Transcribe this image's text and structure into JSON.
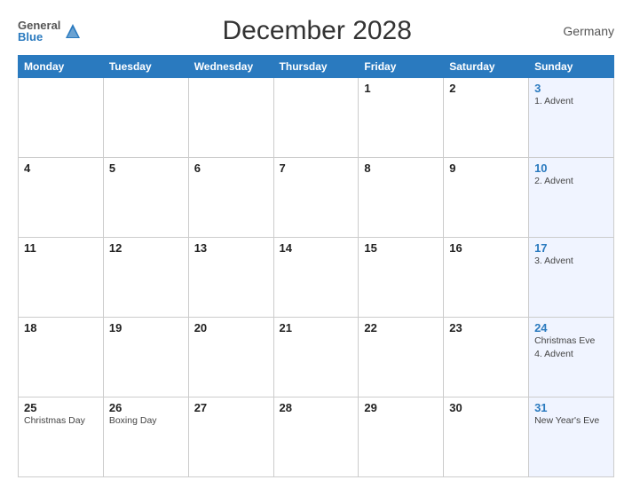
{
  "header": {
    "logo_general": "General",
    "logo_blue": "Blue",
    "title": "December 2028",
    "country": "Germany"
  },
  "weekdays": [
    "Monday",
    "Tuesday",
    "Wednesday",
    "Thursday",
    "Friday",
    "Saturday",
    "Sunday"
  ],
  "weeks": [
    {
      "days": [
        {
          "num": "",
          "holiday": ""
        },
        {
          "num": "",
          "holiday": ""
        },
        {
          "num": "",
          "holiday": ""
        },
        {
          "num": "",
          "holiday": ""
        },
        {
          "num": "1",
          "holiday": ""
        },
        {
          "num": "2",
          "holiday": ""
        },
        {
          "num": "3",
          "holiday": "1. Advent",
          "blue": true
        }
      ]
    },
    {
      "days": [
        {
          "num": "4",
          "holiday": ""
        },
        {
          "num": "5",
          "holiday": ""
        },
        {
          "num": "6",
          "holiday": ""
        },
        {
          "num": "7",
          "holiday": ""
        },
        {
          "num": "8",
          "holiday": ""
        },
        {
          "num": "9",
          "holiday": ""
        },
        {
          "num": "10",
          "holiday": "2. Advent",
          "blue": true
        }
      ]
    },
    {
      "days": [
        {
          "num": "11",
          "holiday": ""
        },
        {
          "num": "12",
          "holiday": ""
        },
        {
          "num": "13",
          "holiday": ""
        },
        {
          "num": "14",
          "holiday": ""
        },
        {
          "num": "15",
          "holiday": ""
        },
        {
          "num": "16",
          "holiday": ""
        },
        {
          "num": "17",
          "holiday": "3. Advent",
          "blue": true
        }
      ]
    },
    {
      "days": [
        {
          "num": "18",
          "holiday": ""
        },
        {
          "num": "19",
          "holiday": ""
        },
        {
          "num": "20",
          "holiday": ""
        },
        {
          "num": "21",
          "holiday": ""
        },
        {
          "num": "22",
          "holiday": ""
        },
        {
          "num": "23",
          "holiday": ""
        },
        {
          "num": "24",
          "holiday": "Christmas Eve\n4. Advent",
          "blue": true
        }
      ]
    },
    {
      "days": [
        {
          "num": "25",
          "holiday": "Christmas Day"
        },
        {
          "num": "26",
          "holiday": "Boxing Day"
        },
        {
          "num": "27",
          "holiday": ""
        },
        {
          "num": "28",
          "holiday": ""
        },
        {
          "num": "29",
          "holiday": ""
        },
        {
          "num": "30",
          "holiday": ""
        },
        {
          "num": "31",
          "holiday": "New Year's Eve",
          "blue": true
        }
      ]
    }
  ]
}
